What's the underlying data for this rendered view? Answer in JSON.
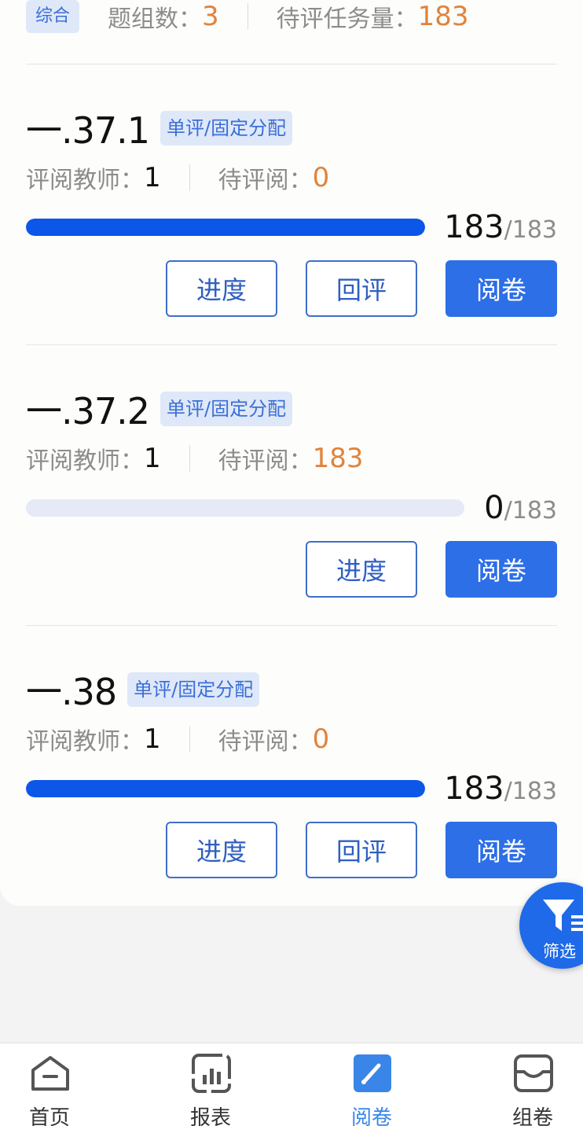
{
  "summary": {
    "category_tag": "综合",
    "group_label": "题组数：",
    "group_count": "3",
    "pending_label": "待评任务量：",
    "pending_count": "183"
  },
  "questions": [
    {
      "title": "一.37.1",
      "badge": "单评/固定分配",
      "teacher_label": "评阅教师：",
      "teacher_count": "1",
      "pending_label": "待评阅：",
      "pending_count": "0",
      "done": "183",
      "total": "/183",
      "progress": 1.0,
      "buttons": [
        "进度",
        "回评",
        "阅卷"
      ]
    },
    {
      "title": "一.37.2",
      "badge": "单评/固定分配",
      "teacher_label": "评阅教师：",
      "teacher_count": "1",
      "pending_label": "待评阅：",
      "pending_count": "183",
      "done": "0",
      "total": "/183",
      "progress": 0.0,
      "buttons": [
        "进度",
        "阅卷"
      ]
    },
    {
      "title": "一.38",
      "badge": "单评/固定分配",
      "teacher_label": "评阅教师：",
      "teacher_count": "1",
      "pending_label": "待评阅：",
      "pending_count": "0",
      "done": "183",
      "total": "/183",
      "progress": 1.0,
      "buttons": [
        "进度",
        "回评",
        "阅卷"
      ]
    }
  ],
  "filter_button": {
    "label": "筛选",
    "icon": "filter-icon"
  },
  "tabbar": {
    "items": [
      {
        "label": "首页",
        "icon": "home-icon"
      },
      {
        "label": "报表",
        "icon": "report-chart-icon"
      },
      {
        "label": "阅卷",
        "icon": "grading-brush-icon",
        "active": true
      },
      {
        "label": "组卷",
        "icon": "paper-tray-icon"
      }
    ]
  },
  "colors": {
    "accent": "#2d6fe6",
    "progress_fill": "#0c56e8",
    "progress_track": "#e6e9f6",
    "highlight_number": "#e0843d",
    "tag_bg": "#dfe8f9",
    "active_tab": "#3a86e8"
  }
}
